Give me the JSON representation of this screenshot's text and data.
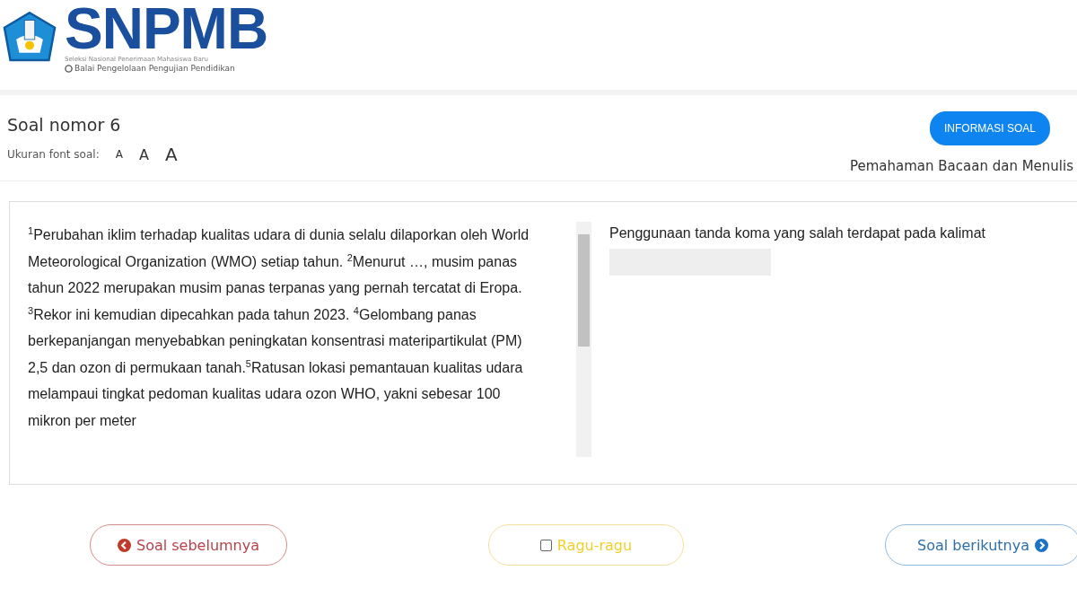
{
  "header": {
    "logo_text": "SNPMB",
    "logo_subtitle": "Seleksi Nasional Penerimaan Mahasiswa Baru",
    "logo_org": "Balai Pengelolaan Pengujian Pendidikan"
  },
  "question": {
    "title": "Soal nomor 6",
    "font_size_label": "Ukuran font soal:",
    "font_sizes": [
      {
        "label": "A",
        "selected": false
      },
      {
        "label": "A",
        "selected": false
      },
      {
        "label": "A",
        "selected": false
      }
    ],
    "buttons": [
      {
        "label": "INFORMASI SOAL"
      }
    ],
    "category": "Pemahaman Bacaan dan Menulis"
  },
  "passage": [
    "$^{1}$Perubahan iklim terhadap kualitas udara di dunia selalu dilaporkan oleh World Meteorological Organization (WMO) setiap tahun. $^{2}$Menurut …, musim panas tahun 2022 merupakan musim panas terpanas yang pernah tercatat di Eropa. $^{3}$Rekor ini kemudian dipecahkan pada tahun 2023. $^{4}$Gelombang panas berkepanjangan menyebabkan peningkatan konsentrasi materipartikulat (PM) 2,5 dan ozon di permukaan tanah.$^{5}$Ratusan lokasi pemantauan kualitas udara melampaui tingkat pedoman kualitas udara ozon WHO, yakni sebesar 100 mikron per meter"
  ],
  "prompt": "Penggunaan tanda koma yang salah terdapat pada kalimat",
  "nav": {
    "prev": "Soal sebelumnya",
    "doubt": {
      "label": "Ragu-ragu",
      "checked": false
    },
    "next": "Soal berikutnya"
  }
}
